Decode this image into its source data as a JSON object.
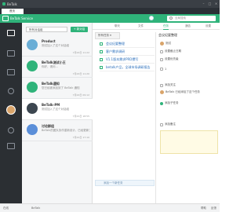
{
  "window": {
    "title": "BeTalk"
  },
  "menu": {
    "tab_label": "首页"
  },
  "header": {
    "brand": "BeTalk Service",
    "search_placeholder": "全局搜索"
  },
  "sidebar": {
    "icons": [
      "chat-icon",
      "contacts-icon",
      "tasks-icon",
      "apps-icon",
      "avatar",
      "bell-icon",
      "settings-icon"
    ]
  },
  "convlist": {
    "filter_label": "所有对话组",
    "new_button": "+ 新对话",
    "items": [
      {
        "name": "Product",
        "snippet": "测试加入了这个对话组",
        "time": "7月22日 11:22",
        "avatar_color": "#6aaed6"
      },
      {
        "name": "BeTalk测试小王",
        "snippet": "你好，请问...",
        "time": "7月22日 11:20",
        "avatar_color": "#2fb37a"
      },
      {
        "name": "BeTalk通知",
        "snippet": "您已经被添加到了 BeTalk 通知",
        "time": "7月22日 09:12",
        "avatar_color": "#2fb37a"
      },
      {
        "name": "BeTalk-PM",
        "snippet": "测试加入了这个对话组",
        "time": "7月21日 18:55",
        "avatar_color": "#3c4650"
      },
      {
        "name": "讨论群组",
        "snippet": "BeTalk的团队协作重新设计，已经更新了...",
        "time": "7月21日 17:10",
        "avatar_color": "#5b8fd9"
      }
    ]
  },
  "main": {
    "tabs": [
      "聊天",
      "文件",
      "任务",
      "通告",
      "设置"
    ],
    "active_tab": "任务",
    "task_filter": "所有任务 ▾",
    "tasks": [
      "会议纪要整理",
      "客户需求调研",
      "V1.1版本需求PRD撰写",
      "betalk产品，全球市场调研报告"
    ],
    "add_task_placeholder": "添加一个新任务"
  },
  "detail": {
    "title": "会议纪要整理",
    "assignee_label": "指派给",
    "assignee_name": "测试",
    "due_label": "设置截止日期",
    "priority_label": "设置优先级",
    "follower_label": "添加关注",
    "follower_count": "1",
    "notification": "BeTalk 已经添加了这个任务",
    "subtask_label": "添加子任务",
    "note_label": "添加备注"
  },
  "status": {
    "left": "在线",
    "mid": "BeTalk",
    "right_1": "帮助",
    "right_2": "反馈"
  }
}
